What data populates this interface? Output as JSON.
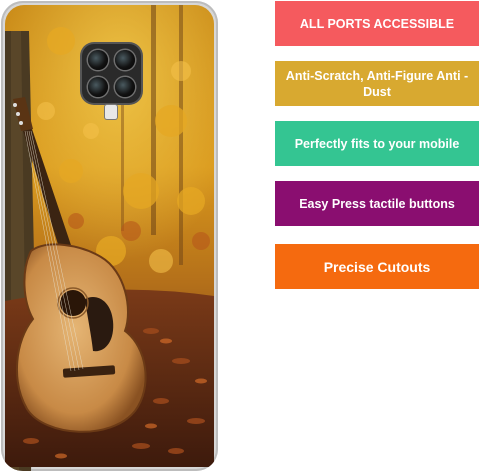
{
  "product": {
    "image_label": "guitar-autumn-forest-phone-case"
  },
  "features": [
    {
      "label": "ALL PORTS ACCESSIBLE",
      "color": "#f55a5e"
    },
    {
      "label": "Anti-Scratch, Anti-Figure Anti -Dust",
      "color": "#d8a930"
    },
    {
      "label": "Perfectly fits  to your mobile",
      "color": "#34c592"
    },
    {
      "label": "Easy Press tactile buttons",
      "color": "#8a0e70"
    },
    {
      "label": "Precise Cutouts",
      "color": "#f56a0f"
    }
  ]
}
